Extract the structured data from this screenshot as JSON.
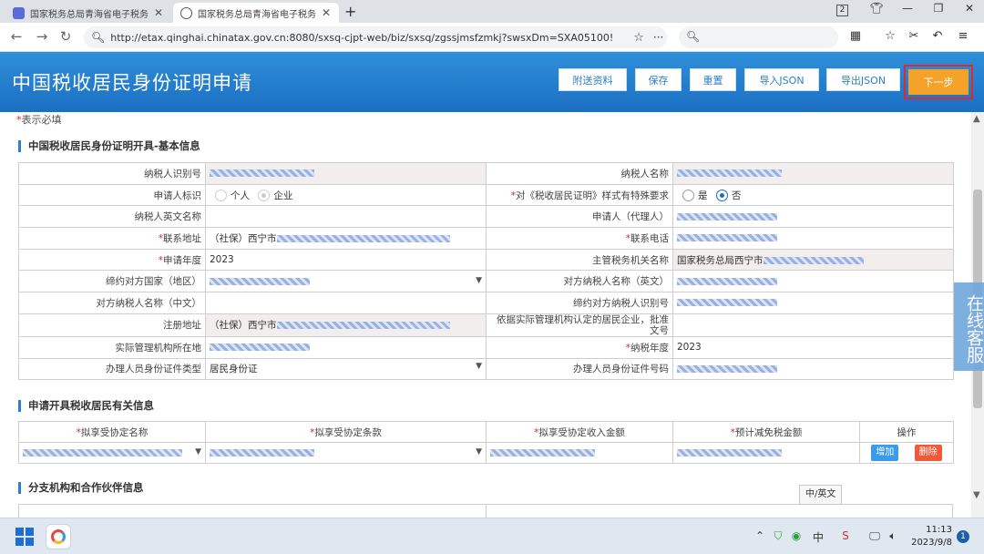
{
  "browser": {
    "tabs": [
      {
        "title": "国家税务总局青海省电子税务局"
      },
      {
        "title": "国家税务总局青海省电子税务局"
      }
    ],
    "url": "http://etax.qinghai.chinatax.gov.cn:8080/sxsq-cjpt-web/biz/sxsq/zgssjmsfzmkj?swsxDm=SXA05100!",
    "tab_count_badge": "2"
  },
  "header": {
    "title": "中国税收居民身份证明申请",
    "buttons": {
      "attach": "附送资料",
      "save": "保存",
      "reset": "重置",
      "import_json": "导入JSON",
      "export_json": "导出JSON",
      "next": "下一步"
    }
  },
  "required_note": {
    "star": "*",
    "text": "表示必填"
  },
  "section1": {
    "title": "中国税收居民身份证明开具-基本信息",
    "labels": {
      "taxpayer_id": "纳税人识别号",
      "taxpayer_name": "纳税人名称",
      "applicant_type": "申请人标识",
      "special_format": "对《税收居民证明》样式有特殊要求",
      "english_name": "纳税人英文名称",
      "applicant_agent": "申请人（代理人）",
      "address": "联系地址",
      "phone": "联系电话",
      "year": "申请年度",
      "tax_authority": "主管税务机关名称",
      "treaty_country": "缔约对方国家（地区）",
      "counterpart_name_en": "对方纳税人名称（英文）",
      "counterpart_name_cn": "对方纳税人名称（中文）",
      "counterpart_id": "缔约对方纳税人识别号",
      "registered_address": "注册地址",
      "resident_doc": "依据实际管理机构认定的居民企业，批准文号",
      "management_location": "实际管理机构所在地",
      "tax_year": "纳税年度",
      "handler_id_type": "办理人员身份证件类型",
      "handler_id_no": "办理人员身份证件号码"
    },
    "values": {
      "applicant_type_options": [
        "个人",
        "企业"
      ],
      "special_format_options": [
        "是",
        "否"
      ],
      "address_prefix": "（社保）西宁市",
      "year": "2023",
      "tax_authority_prefix": "国家税务总局西宁市",
      "registered_address_prefix": "（社保）西宁市",
      "tax_year": "2023",
      "handler_id_type": "居民身份证"
    }
  },
  "section2": {
    "title": "申请开具税收居民有关信息",
    "columns": [
      "拟享受协定名称",
      "拟享受协定条款",
      "拟享受协定收入金额",
      "预计减免税金额",
      "操作"
    ],
    "actions": {
      "add": "增加",
      "delete": "删除"
    }
  },
  "section3": {
    "title": "分支机构和合作伙伴信息"
  },
  "ime_tip": "中/英文",
  "service_float": "在线客服",
  "taskbar": {
    "time": "11:13",
    "date": "2023/9/8",
    "notifications": "1"
  },
  "colors": {
    "header_blue": "#1b6fc2",
    "next_orange": "#f5a22a",
    "highlight_red": "#e0292d",
    "required_red": "#e02020",
    "add_blue": "#3a9be8",
    "delete_red": "#f05a3a"
  }
}
